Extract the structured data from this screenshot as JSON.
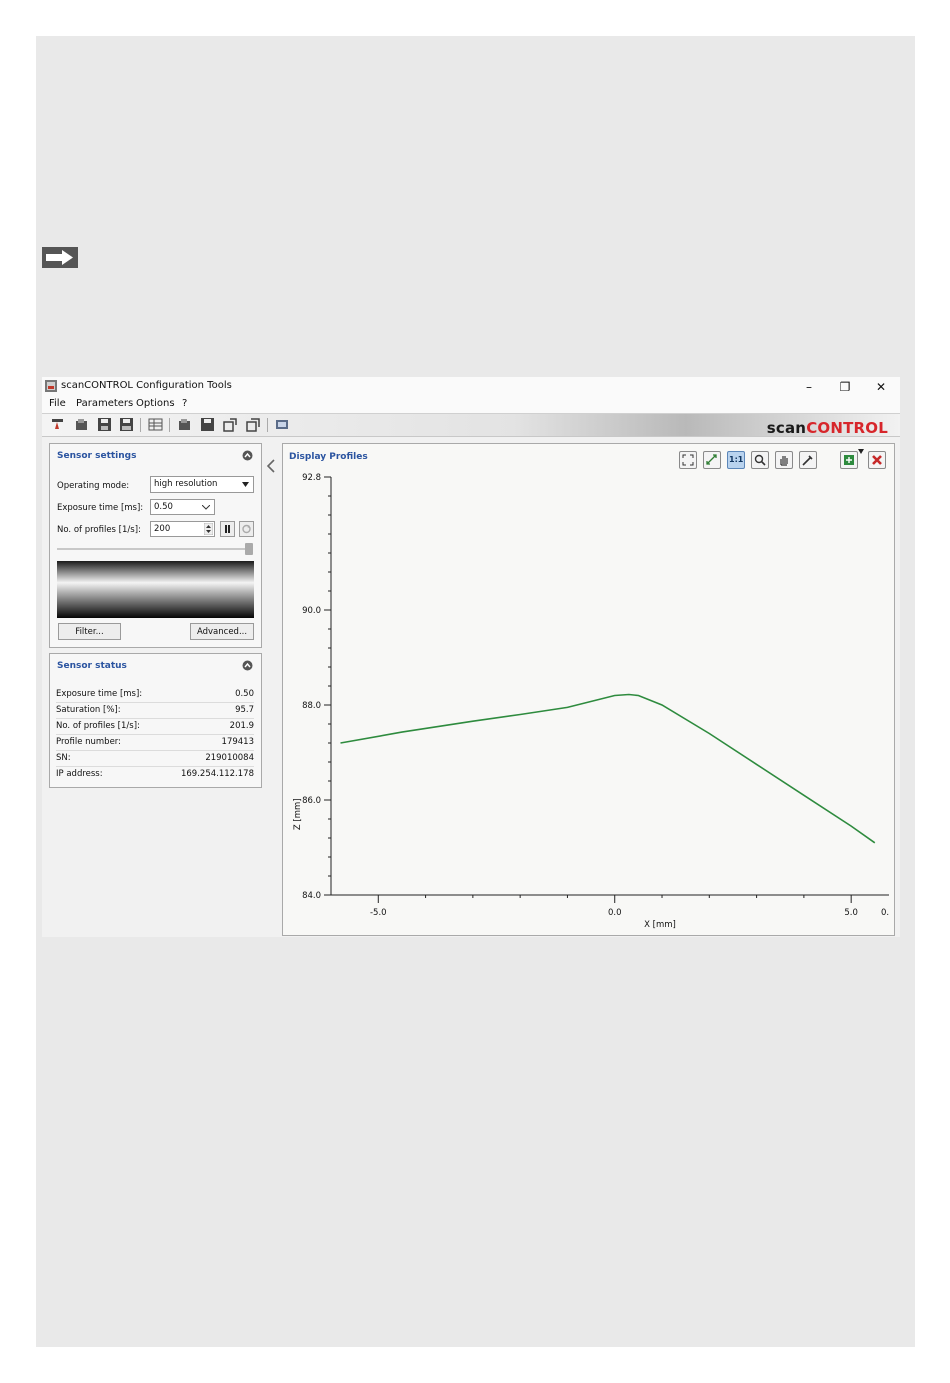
{
  "window": {
    "title": "scanCONTROL Configuration Tools",
    "controls": {
      "minimize": "–",
      "restore": "❐",
      "close": "✕"
    }
  },
  "menu": [
    "File",
    "Parameters",
    "Options",
    "?"
  ],
  "brand": {
    "part1": "scan",
    "part2": "CONTROL",
    "color_part2": "#d7262b"
  },
  "sensor_settings": {
    "title": "Sensor settings",
    "operating_mode_label": "Operating mode:",
    "operating_mode_value": "high resolution",
    "exposure_label": "Exposure time [ms]:",
    "exposure_value": "0.50",
    "profiles_label": "No. of profiles [1/s]:",
    "profiles_value": "200",
    "filter_button": "Filter...",
    "advanced_button": "Advanced..."
  },
  "sensor_status": {
    "title": "Sensor status",
    "rows": [
      {
        "key": "Exposure time [ms]:",
        "value": "0.50"
      },
      {
        "key": "Saturation [%]:",
        "value": "95.7"
      },
      {
        "key": "No. of profiles [1/s]:",
        "value": "201.9"
      },
      {
        "key": "Profile number:",
        "value": "179413"
      },
      {
        "key": "SN:",
        "value": "219010084"
      },
      {
        "key": "IP address:",
        "value": "169.254.112.178"
      }
    ]
  },
  "display_profiles": {
    "title": "Display Profiles",
    "zoom_label": "1:1"
  },
  "chart_data": {
    "type": "line",
    "title": "",
    "xlabel": "X [mm]",
    "ylabel": "Z [mm]",
    "xlim": [
      -6.0,
      5.8
    ],
    "ylim": [
      84.0,
      92.8
    ],
    "x_ticks": [
      -5.0,
      0.0,
      5.0
    ],
    "x_tick_labels": [
      "-5.0",
      "0.0",
      "5.0",
      "0."
    ],
    "y_ticks": [
      92.8,
      90.0,
      88.0,
      86.0,
      84.0
    ],
    "y_tick_labels": [
      "92.8",
      "90.0",
      "88.0",
      "86.0",
      "84.0"
    ],
    "line_color": "#2e8b3e",
    "grid": false,
    "series": [
      {
        "x": [
          -5.8,
          -4.5,
          -3.0,
          -2.0,
          -1.0,
          0.0,
          0.3,
          0.5,
          1.0,
          2.0,
          3.0,
          4.0,
          5.0,
          5.5
        ],
        "z": [
          87.2,
          87.43,
          87.66,
          87.8,
          87.95,
          88.2,
          88.22,
          88.2,
          88.0,
          87.4,
          86.75,
          86.1,
          85.45,
          85.1
        ]
      }
    ]
  }
}
